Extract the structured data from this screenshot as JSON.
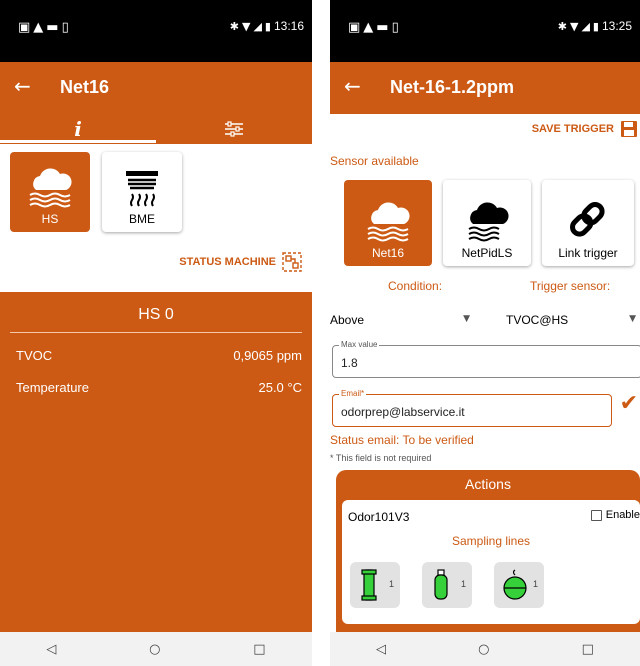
{
  "left_screen": {
    "status_bar": {
      "time": "13:16"
    },
    "app_bar": {
      "title": "Net16"
    },
    "tabs": [
      {
        "label": "i",
        "icon": "info-icon"
      },
      {
        "icon": "settings-sliders-icon"
      }
    ],
    "sensors": [
      {
        "label": "HS",
        "icon": "cloud-fog-icon",
        "selected": true
      },
      {
        "label": "BME",
        "icon": "vent-icon",
        "selected": false
      }
    ],
    "status_machine_label": "STATUS MACHINE",
    "panel": {
      "title": "HS 0",
      "rows": [
        {
          "label": "TVOC",
          "value": "0,9065 ppm"
        },
        {
          "label": "Temperature",
          "value": "25.0 °C"
        }
      ]
    },
    "nav": {
      "back": "◁",
      "home": "○",
      "recents": "□"
    }
  },
  "right_screen": {
    "status_bar": {
      "time": "13:25"
    },
    "app_bar": {
      "title": "Net-16-1.2ppm"
    },
    "save_trigger_label": "SAVE TRIGGER",
    "sensor_available_label": "Sensor available",
    "sensors": [
      {
        "label": "Net16",
        "icon": "cloud-fog-icon",
        "selected": true
      },
      {
        "label": "NetPidLS",
        "icon": "storm-cloud-icon",
        "selected": false
      },
      {
        "label": "Link trigger",
        "icon": "link-icon",
        "selected": false
      }
    ],
    "condition_label": "Condition:",
    "trigger_sensor_label": "Trigger sensor:",
    "condition_value": "Above",
    "trigger_sensor_value": "TVOC@HS",
    "max_value": {
      "label": "Max value",
      "value": "1.8"
    },
    "email": {
      "label": "Email*",
      "value": "odorprep@labservice.it"
    },
    "status_email": "Status email:  To be verified",
    "not_required_note": "* This field is not required",
    "actions": {
      "title": "Actions",
      "name": "Odor101V3",
      "enable_label": "Enable",
      "sampling_lines_label": "Sampling lines",
      "lines": [
        {
          "count": "1",
          "icon": "green-tube-icon"
        },
        {
          "count": "1",
          "icon": "green-canister-icon"
        },
        {
          "count": "1",
          "icon": "green-bag-icon"
        }
      ]
    },
    "nav": {
      "back": "◁",
      "home": "○",
      "recents": "□"
    }
  },
  "colors": {
    "accent": "#cc5a14",
    "line_green": "#35d03a"
  }
}
